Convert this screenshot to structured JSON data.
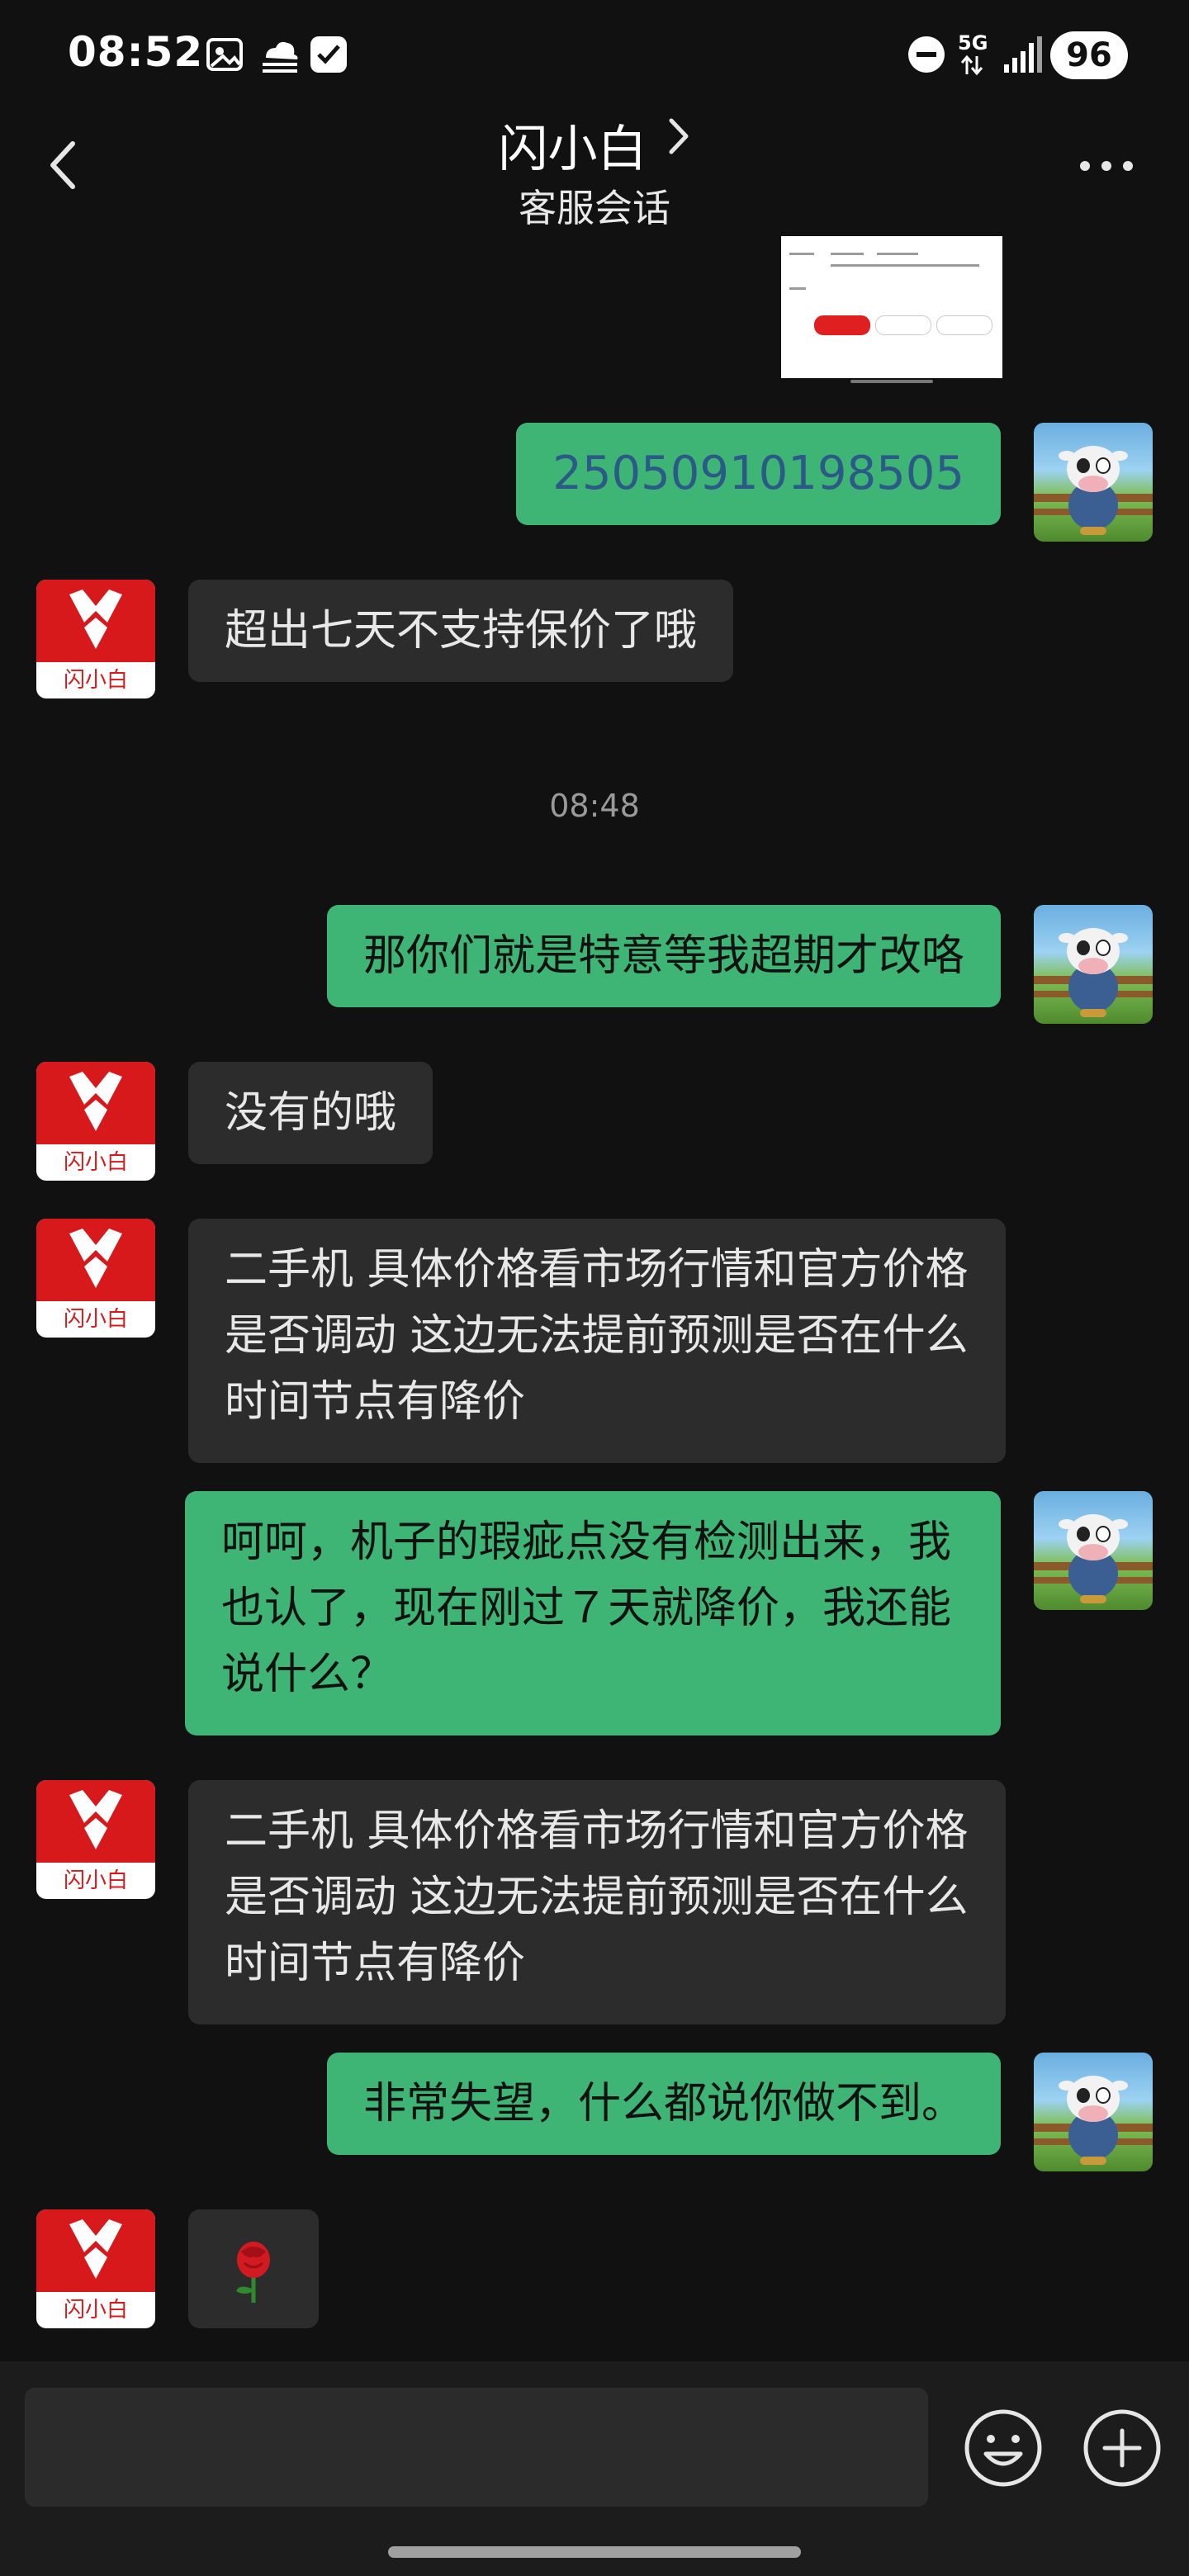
{
  "status_bar": {
    "time": "08:52",
    "network": "5G",
    "battery": "96"
  },
  "header": {
    "title": "闪小白",
    "subtitle": "客服会话"
  },
  "chat": {
    "bot_name": "闪小白",
    "messages": [
      {
        "from": "user",
        "text": "25050910198505"
      },
      {
        "from": "bot",
        "text": "超出七天不支持保价了哦"
      },
      {
        "time": "08:48"
      },
      {
        "from": "user",
        "text": "那你们就是特意等我超期才改咯"
      },
      {
        "from": "bot",
        "text": "没有的哦"
      },
      {
        "from": "bot",
        "text": "二手机 具体价格看市场行情和官方价格是否调动 这边无法提前预测是否在什么时间节点有降价"
      },
      {
        "from": "user",
        "text": "呵呵，机子的瑕疵点没有检测出来，我也认了，现在刚过７天就降价，我还能说什么？"
      },
      {
        "from": "bot",
        "text": "二手机 具体价格看市场行情和官方价格是否调动 这边无法提前预测是否在什么时间节点有降价"
      },
      {
        "from": "user",
        "text": "非常失望，什么都说你做不到。"
      },
      {
        "from": "bot",
        "text": "🌹"
      }
    ]
  },
  "input": {
    "value": "",
    "placeholder": ""
  },
  "icons": {
    "back": "chevron-left-icon",
    "more": "more-dots-icon",
    "emoji": "emoji-icon",
    "add": "plus-icon"
  },
  "colors": {
    "background": "#111111",
    "sent_bubble": "#3eb575",
    "received_bubble": "#2c2c2c",
    "brand_red": "#d7191c"
  }
}
